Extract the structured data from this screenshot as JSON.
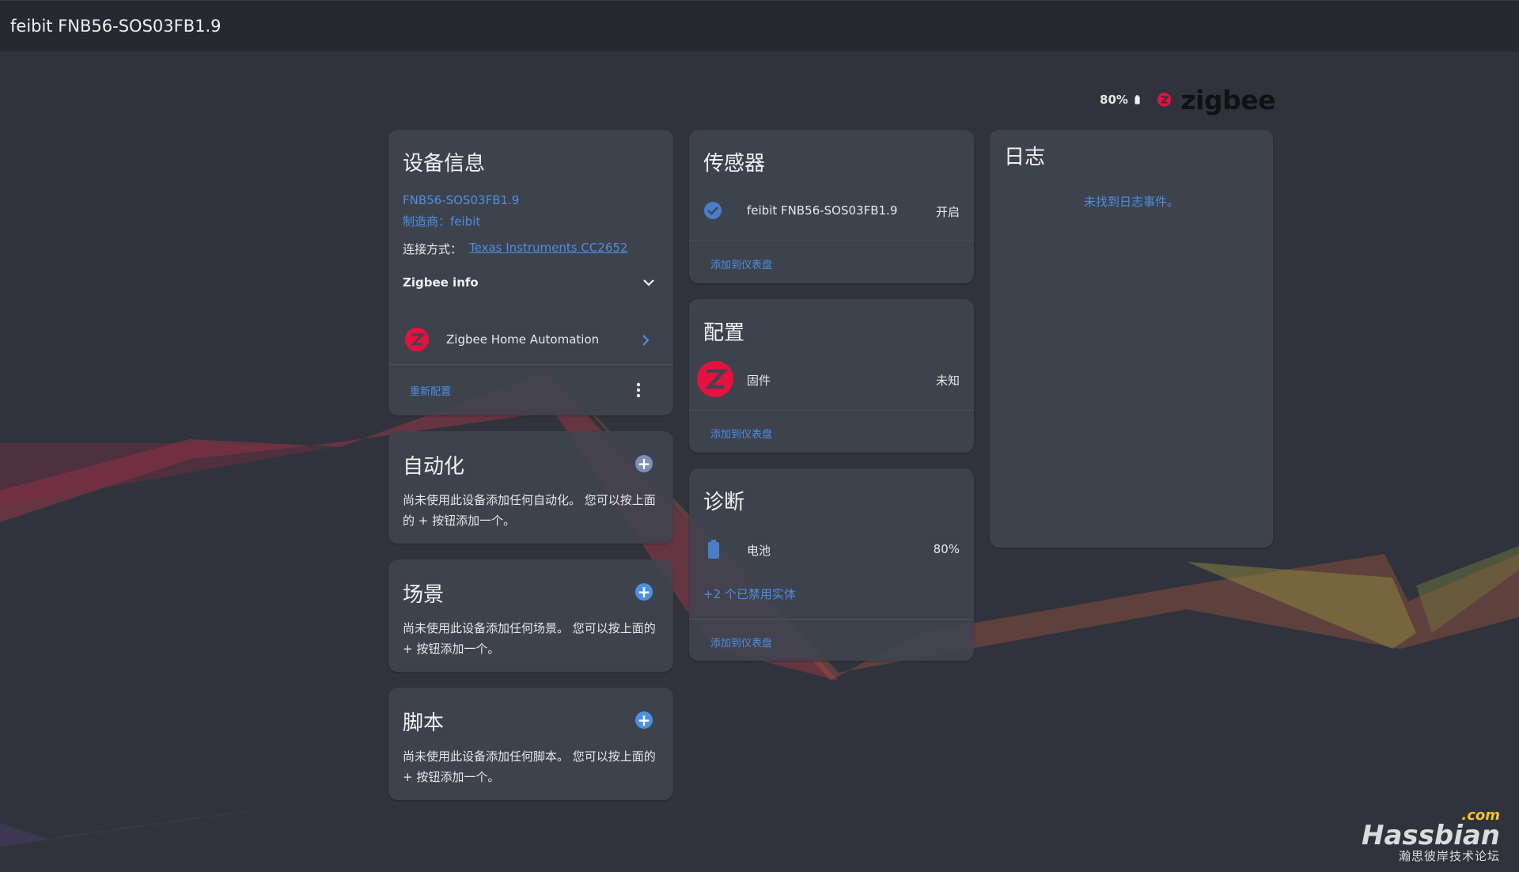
{
  "topbar": {
    "title": "feibit FNB56-SOS03FB1.9"
  },
  "brand": {
    "battery_pct": "80%",
    "logo_text": "zigbee",
    "logo_color": "#e5113f"
  },
  "device_info": {
    "title": "设备信息",
    "model": "FNB56-SOS03FB1.9",
    "manufacturer": "制造商：feibit",
    "connection_label": "连接方式：",
    "connection_value": "Texas Instruments CC2652",
    "zigbee_info_label": "Zigbee info",
    "integration_label": "Zigbee Home Automation",
    "reconfigure_label": "重新配置"
  },
  "automation": {
    "title": "自动化",
    "empty_text": "尚未使用此设备添加任何自动化。 您可以按上面的 + 按钮添加一个。"
  },
  "scene": {
    "title": "场景",
    "empty_text": "尚未使用此设备添加任何场景。 您可以按上面的 + 按钮添加一个。"
  },
  "script": {
    "title": "脚本",
    "empty_text": "尚未使用此设备添加任何脚本。 您可以按上面的 + 按钮添加一个。"
  },
  "sensors": {
    "title": "传感器",
    "entity_name": "feibit FNB56-SOS03FB1.9",
    "entity_state": "开启",
    "add_to_dashboard": "添加到仪表盘"
  },
  "config": {
    "title": "配置",
    "entity_name": "固件",
    "entity_state": "未知",
    "add_to_dashboard": "添加到仪表盘"
  },
  "diagnostic": {
    "title": "诊断",
    "entity_name": "电池",
    "entity_state": "80%",
    "disabled_entities": "+2 个已禁用实体",
    "add_to_dashboard": "添加到仪表盘"
  },
  "logbook": {
    "title": "日志",
    "empty_text": "未找到日志事件。"
  },
  "watermark": {
    "com": ".com",
    "main": "Hassbian",
    "sub": "瀚思彼岸技术论坛"
  }
}
